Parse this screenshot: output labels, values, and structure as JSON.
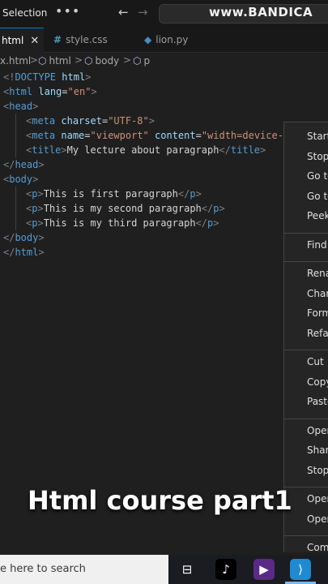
{
  "topbar": {
    "menu_label": "Selection",
    "more_label": "•••",
    "back_arrow": "←",
    "forward_arrow": "→",
    "watermark": "www.BANDICA"
  },
  "tabs": [
    {
      "icon": "<>",
      "label": "html",
      "close": "✕",
      "active": true
    },
    {
      "icon": "#",
      "label": "style.css",
      "active": false
    },
    {
      "icon": "◆",
      "label": "lion.py",
      "active": false
    }
  ],
  "breadcrumb": {
    "file": "x.html",
    "items": [
      "html",
      "body",
      "p"
    ],
    "separator": ">"
  },
  "editor": {
    "lines": [
      {
        "indent": 0,
        "tokens": [
          [
            "p",
            "<!"
          ],
          [
            "t",
            "DOCTYPE"
          ],
          [
            "w",
            " "
          ],
          [
            "a",
            "html"
          ],
          [
            "p",
            ">"
          ]
        ]
      },
      {
        "indent": 0,
        "tokens": [
          [
            "p",
            "<"
          ],
          [
            "t",
            "html"
          ],
          [
            "w",
            " "
          ],
          [
            "a",
            "lang"
          ],
          [
            "w",
            "="
          ],
          [
            "s",
            "\"en\""
          ],
          [
            "p",
            ">"
          ]
        ]
      },
      {
        "indent": 0,
        "tokens": [
          [
            "p",
            "<"
          ],
          [
            "t",
            "head"
          ],
          [
            "p",
            ">"
          ]
        ]
      },
      {
        "indent": 1,
        "tokens": [
          [
            "p",
            "<"
          ],
          [
            "t",
            "meta"
          ],
          [
            "w",
            " "
          ],
          [
            "a",
            "charset"
          ],
          [
            "w",
            "="
          ],
          [
            "s",
            "\"UTF-8\""
          ],
          [
            "p",
            ">"
          ]
        ]
      },
      {
        "indent": 1,
        "tokens": [
          [
            "p",
            "<"
          ],
          [
            "t",
            "meta"
          ],
          [
            "w",
            " "
          ],
          [
            "a",
            "name"
          ],
          [
            "w",
            "="
          ],
          [
            "s",
            "\"viewport\""
          ],
          [
            "w",
            " "
          ],
          [
            "a",
            "content"
          ],
          [
            "w",
            "="
          ],
          [
            "s",
            "\"width=device-"
          ]
        ]
      },
      {
        "indent": 1,
        "tokens": [
          [
            "p",
            "<"
          ],
          [
            "t",
            "title"
          ],
          [
            "p",
            ">"
          ],
          [
            "w",
            "My lecture about paragraph"
          ],
          [
            "p",
            "</"
          ],
          [
            "t",
            "title"
          ],
          [
            "p",
            ">"
          ]
        ]
      },
      {
        "indent": 0,
        "tokens": [
          [
            "p",
            "</"
          ],
          [
            "t",
            "head"
          ],
          [
            "p",
            ">"
          ]
        ]
      },
      {
        "indent": 0,
        "tokens": [
          [
            "p",
            "<"
          ],
          [
            "t",
            "body"
          ],
          [
            "p",
            ">"
          ]
        ]
      },
      {
        "indent": 1,
        "tokens": [
          [
            "p",
            "<"
          ],
          [
            "t",
            "p"
          ],
          [
            "p",
            ">"
          ],
          [
            "w",
            "This is first paragraph"
          ],
          [
            "p",
            "</"
          ],
          [
            "t",
            "p"
          ],
          [
            "p",
            ">"
          ]
        ]
      },
      {
        "indent": 1,
        "tokens": [
          [
            "p",
            "<"
          ],
          [
            "t",
            "p"
          ],
          [
            "p",
            ">"
          ],
          [
            "w",
            "This is my second paragraph"
          ],
          [
            "p",
            "</"
          ],
          [
            "t",
            "p"
          ],
          [
            "p",
            ">"
          ]
        ]
      },
      {
        "indent": 1,
        "tokens": [
          [
            "p",
            "<"
          ],
          [
            "t",
            "p"
          ],
          [
            "p",
            ">"
          ],
          [
            "w",
            "This is my third paragraph"
          ],
          [
            "p",
            "</"
          ],
          [
            "t",
            "p"
          ],
          [
            "p",
            ">"
          ]
        ]
      },
      {
        "indent": 0,
        "tokens": [
          [
            "p",
            "</"
          ],
          [
            "t",
            "body"
          ],
          [
            "p",
            ">"
          ]
        ]
      },
      {
        "indent": 0,
        "tokens": [
          [
            "p",
            "</"
          ],
          [
            "t",
            "html"
          ],
          [
            "p",
            ">"
          ]
        ]
      }
    ]
  },
  "context_menu": {
    "groups": [
      [
        "Start",
        "Stop",
        "Go to",
        "Go to",
        "Peek"
      ],
      [
        "Find"
      ],
      [
        "Rena",
        "Chan",
        "Form",
        "Refac"
      ],
      [
        "Cut",
        "Copy",
        "Paste"
      ],
      [
        "Open",
        "Share",
        "Stop"
      ],
      [
        "Open",
        "Open"
      ],
      [
        "Comm"
      ]
    ]
  },
  "overlay_text": "Html course part1",
  "taskbar": {
    "search_text": "e here to search",
    "icons": [
      {
        "name": "task-view-icon",
        "glyph": "⊟",
        "color": "#ffffff",
        "bg": "transparent"
      },
      {
        "name": "tiktok-icon",
        "glyph": "♪",
        "color": "#ffffff",
        "bg": "#000000"
      },
      {
        "name": "video-app-icon",
        "glyph": "▶",
        "color": "#ffffff",
        "bg": "#5b2a86"
      },
      {
        "name": "vscode-icon",
        "glyph": "⟩",
        "color": "#ffffff",
        "bg": "#1f8ad2"
      }
    ]
  }
}
